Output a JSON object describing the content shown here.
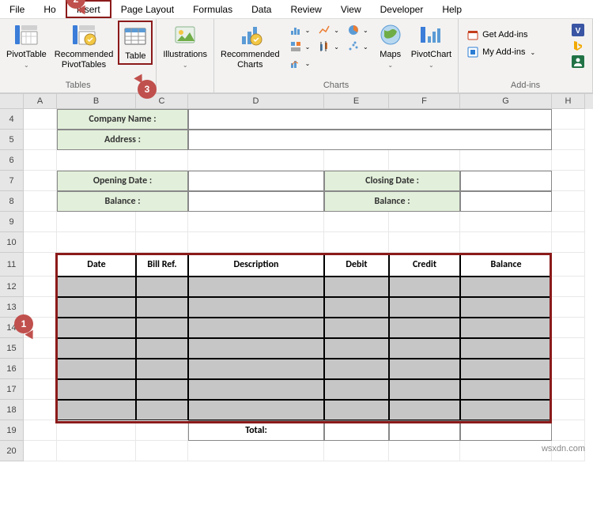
{
  "menu": {
    "file": "File",
    "home": "Ho",
    "insert": "Insert",
    "page_layout": "Page Layout",
    "formulas": "Formulas",
    "data": "Data",
    "review": "Review",
    "view": "View",
    "developer": "Developer",
    "help": "Help"
  },
  "ribbon": {
    "tables": {
      "pivot_table": "PivotTable",
      "recommended": "Recommended\nPivotTables",
      "table": "Table",
      "label": "Tables"
    },
    "illustrations": {
      "btn": "Illustrations",
      "label": ""
    },
    "charts": {
      "recommended": "Recommended\nCharts",
      "maps": "Maps",
      "pivot_chart": "PivotChart",
      "label": "Charts"
    },
    "addins": {
      "get": "Get Add-ins",
      "my": "My Add-ins",
      "label": "Add-ins"
    }
  },
  "callouts": {
    "c1": "1",
    "c2": "2",
    "c3": "3"
  },
  "cols": {
    "a": "A",
    "b": "B",
    "c": "C",
    "d": "D",
    "e": "E",
    "f": "F",
    "g": "G",
    "h": "H"
  },
  "rows": {
    "r4": "4",
    "r5": "5",
    "r6": "6",
    "r7": "7",
    "r8": "8",
    "r9": "9",
    "r10": "10",
    "r11": "11",
    "r12": "12",
    "r13": "13",
    "r14": "14",
    "r15": "15",
    "r16": "16",
    "r17": "17",
    "r18": "18",
    "r19": "19",
    "r20": "20"
  },
  "sheet": {
    "company_name": "Company Name :",
    "address": "Address :",
    "opening_date": "Opening Date :",
    "closing_date": "Closing Date :",
    "balance_left": "Balance :",
    "balance_right": "Balance :",
    "headers": {
      "date": "Date",
      "bill_ref": "Bill Ref.",
      "description": "Description",
      "debit": "Debit",
      "credit": "Credit",
      "balance": "Balance"
    },
    "total": "Total:"
  },
  "watermark": "wsxdn.com"
}
